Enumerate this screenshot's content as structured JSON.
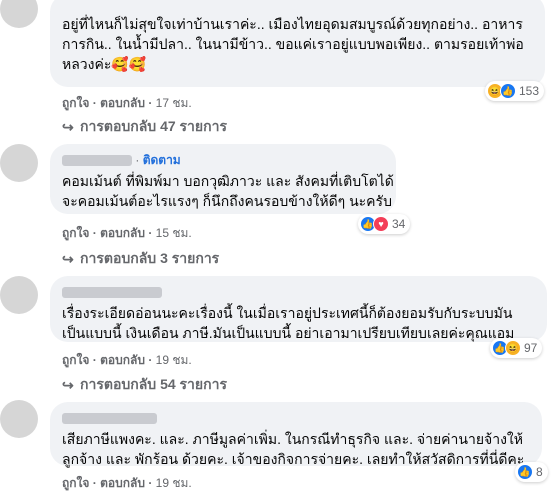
{
  "comments": [
    {
      "lines": [
        "อยู่ที่ไหนก็ไม่สุขใจเท่าบ้านเราค่ะ.. เมืองไทยอุดมสมบูรณ์ด้วยทุกอย่าง.. อาหาร",
        "การกิน.. ในน้ำมีปลา.. ในนามีข้าว.. ขอแค่เราอยู่แบบพอเพียง.. ตามรอยเท้าพ่อ",
        "หลวงค่ะ🥰🥰"
      ],
      "reactions": {
        "icons": [
          "haha",
          "like"
        ],
        "count": "153"
      },
      "actions": {
        "like": "ถูกใจ",
        "reply": "ตอบกลับ",
        "time": "17 ชม."
      },
      "replies": "การตอบกลับ 47 รายการ"
    },
    {
      "header": {
        "follow": "ติดตาม"
      },
      "lines": [
        "คอมเม้นต์ ที่พิมพ์มา บอกวุฒิภาวะ และ สังคมที่เติบโตได้",
        "จะคอมเม้นต์อะไรแรงๆ ก็นึกถึงคนรอบข้างให้ดีๆ นะครับ"
      ],
      "reactions": {
        "icons": [
          "like",
          "love"
        ],
        "count": "34"
      },
      "actions": {
        "like": "ถูกใจ",
        "reply": "ตอบกลับ",
        "time": "15 ชม."
      },
      "replies": "การตอบกลับ 3 รายการ"
    },
    {
      "lines": [
        "เรื่องระเอียดอ่อนนะคะเรื่องนี้ ในเมื่อเราอยู่ประเทศนี้ก็ต้องยอมรับกับระบบมัน",
        "เป็นแบบนี้ เงินเดือน ภาษี.มันเป็นแบบนี้ อย่าเอามาเปรียบเทียบเลยค่ะคุณแอม"
      ],
      "reactions": {
        "icons": [
          "like",
          "haha"
        ],
        "count": "97"
      },
      "actions": {
        "like": "ถูกใจ",
        "reply": "ตอบกลับ",
        "time": "19 ชม."
      },
      "replies": "การตอบกลับ 54 รายการ"
    },
    {
      "lines": [
        "เสียภาษีแพงคะ. และ. ภาษีมูลค่าเพิ่ม. ในกรณีทำธุรกิจ และ. จ่ายค่านายจ้างให้",
        "ลูกจ้าง และ พักร้อน ด้วยคะ. เจ้าของกิจการจ่ายคะ. เลยทำให้สวัสดิการที่นี่ดีคะ."
      ],
      "reactions": {
        "icons": [
          "like"
        ],
        "count": "8"
      },
      "actions": {
        "like": "ถูกใจ",
        "reply": "ตอบกลับ",
        "time": "19 ชม."
      }
    }
  ],
  "colors": {
    "bubble": "#f0f2f5",
    "link": "#216fdb",
    "meta": "#65676b",
    "like": "#1877f2",
    "love": "#f33e58",
    "haha": "#f7b125"
  }
}
